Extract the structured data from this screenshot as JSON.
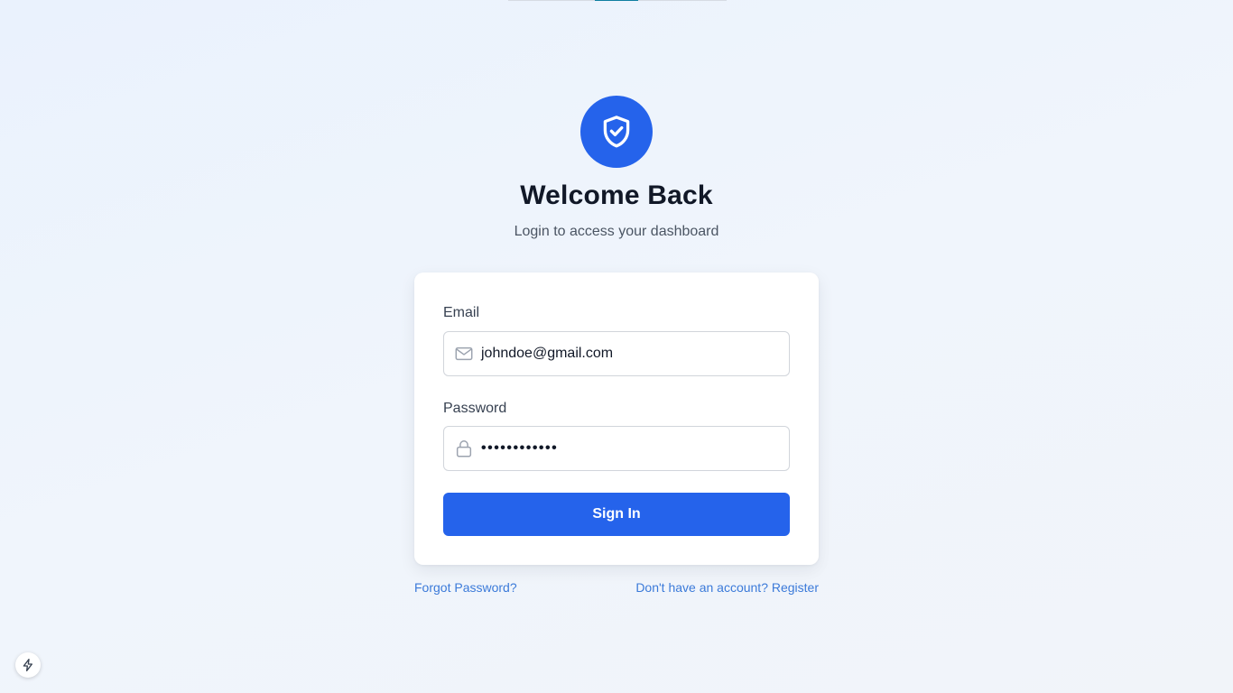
{
  "header": {
    "title": "Welcome Back",
    "subtitle": "Login to access your dashboard",
    "logo_icon": "shield-check-icon"
  },
  "form": {
    "email": {
      "label": "Email",
      "value": "johndoe@gmail.com",
      "icon": "mail-icon"
    },
    "password": {
      "label": "Password",
      "value": "••••••••••••",
      "icon": "lock-icon"
    },
    "submit_label": "Sign In"
  },
  "links": {
    "forgot": "Forgot Password?",
    "register": "Don't have an account? Register"
  },
  "colors": {
    "accent": "#2563eb",
    "link": "#3b7ad9",
    "background": "#eef4fc"
  }
}
